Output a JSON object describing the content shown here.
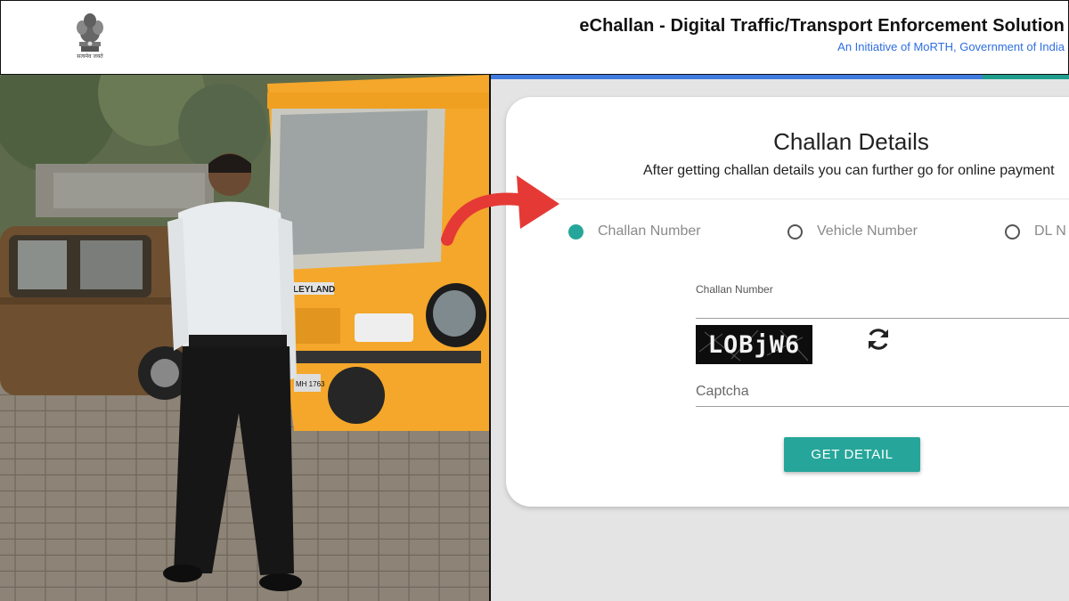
{
  "header": {
    "emblem_caption": "सत्यमेव जयते",
    "title": "eChallan - Digital Traffic/Transport Enforcement Solution",
    "subtitle": "An Initiative of MoRTH, Government of India"
  },
  "photo": {
    "bus_brand": "LEYLAND",
    "plate": "MH 1763"
  },
  "card": {
    "title": "Challan Details",
    "subtitle": "After getting challan details you can further go for online payment"
  },
  "search_options": [
    {
      "label": "Challan Number",
      "selected": true
    },
    {
      "label": "Vehicle Number",
      "selected": false
    },
    {
      "label": "DL N",
      "selected": false
    }
  ],
  "form": {
    "challan_label": "Challan Number",
    "challan_value": "",
    "captcha_text": "LOBjW6",
    "captcha_placeholder": "Captcha",
    "submit_label": "GET DETAIL"
  },
  "colors": {
    "accent_teal": "#26a69a",
    "header_blue": "#2f6ee0",
    "arrow_red": "#e53935"
  },
  "icons": {
    "refresh": "refresh-icon",
    "emblem": "national-emblem-icon",
    "arrow": "pointer-arrow-icon"
  }
}
